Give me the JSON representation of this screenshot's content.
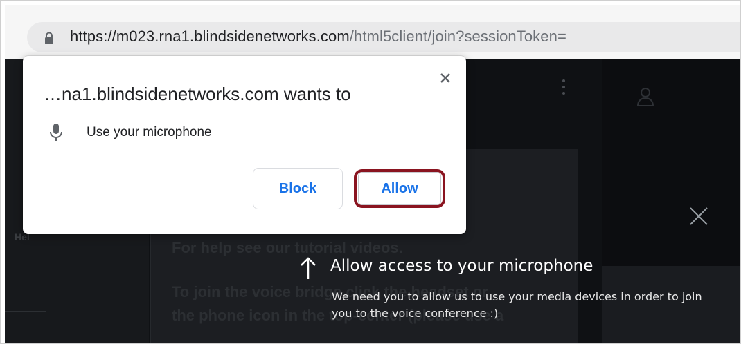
{
  "browser": {
    "url_host": "https://m023.rna1.blindsidenetworks.com",
    "url_path": "/html5client/join?sessionToken="
  },
  "page": {
    "nav_label": "Hel",
    "help_line1": "For help see our tutorial videos.",
    "help_line2": "To join the voice bridge click the headset or",
    "help_line3": "the phone icon in the top-center (please use a"
  },
  "hint": {
    "title": "Allow access to your microphone",
    "body": "We need you to allow us to use your media devices in order to join you to the voice conference :)"
  },
  "permission_popup": {
    "title": "…na1.blindsidenetworks.com wants to",
    "permission": "Use your microphone",
    "block_label": "Block",
    "allow_label": "Allow"
  },
  "colors": {
    "button_text": "#1a73e8",
    "highlight_outline": "#8a1420",
    "page_bg": "#0f1114"
  }
}
